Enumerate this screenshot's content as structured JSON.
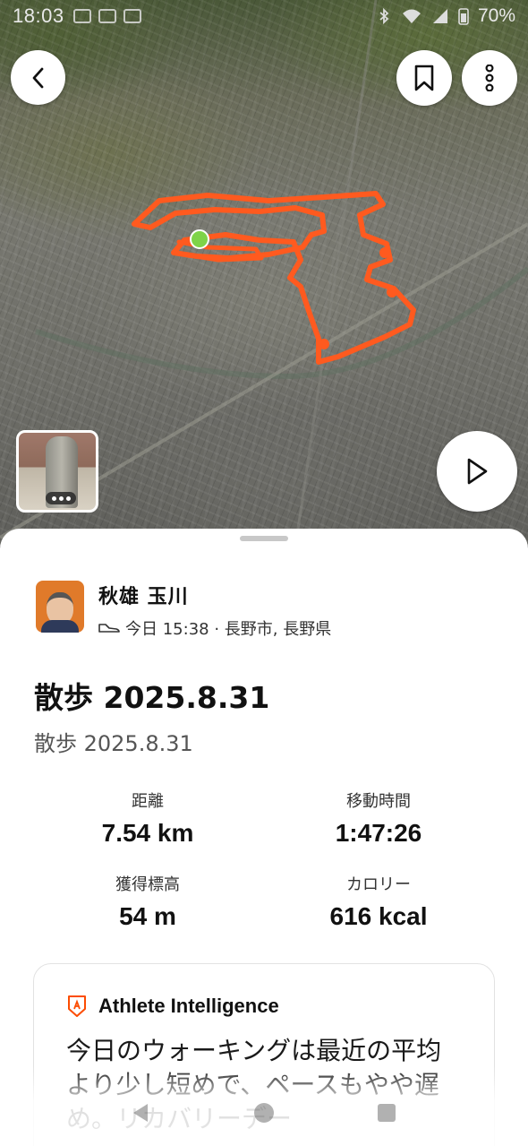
{
  "status_bar": {
    "time": "18:03",
    "battery": "70%"
  },
  "map": {
    "route_color": "#FF5A1F",
    "start_marker_color": "#7ED348"
  },
  "photo_thumbnail": {
    "more_indicator": "•••"
  },
  "activity": {
    "athlete_name": "秋雄 玉川",
    "meta": "今日 15:38 · 長野市, 長野県",
    "title": "散歩 2025.8.31",
    "description": "散歩 2025.8.31"
  },
  "stats": [
    {
      "label": "距離",
      "value": "7.54 km"
    },
    {
      "label": "移動時間",
      "value": "1:47:26"
    },
    {
      "label": "獲得標高",
      "value": "54 m"
    },
    {
      "label": "カロリー",
      "value": "616 kcal"
    }
  ],
  "athlete_intelligence": {
    "title": "Athlete Intelligence",
    "text": "今日のウォーキングは最近の平均より少し短めで、ペースもやや遅め。リカバリーデー"
  },
  "colors": {
    "accent": "#FC4C02",
    "text_primary": "#111111"
  }
}
